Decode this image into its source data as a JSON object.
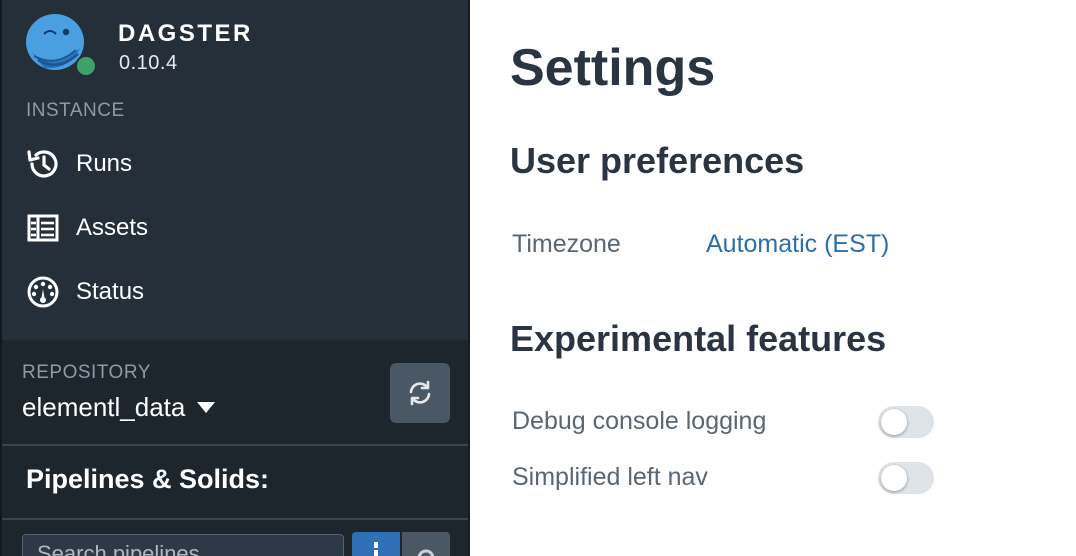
{
  "brand": {
    "name": "DAGSTER",
    "version": "0.10.4"
  },
  "sidebar": {
    "instance_label": "INSTANCE",
    "nav": [
      {
        "label": "Runs",
        "icon": "history-icon"
      },
      {
        "label": "Assets",
        "icon": "table-icon"
      },
      {
        "label": "Status",
        "icon": "dashboard-icon"
      }
    ],
    "repository_label": "REPOSITORY",
    "repository_value": "elementl_data",
    "pipelines_title": "Pipelines & Solids:",
    "search_placeholder": "Search pipelines..."
  },
  "main": {
    "title": "Settings",
    "user_prefs_title": "User preferences",
    "timezone_label": "Timezone",
    "timezone_value": "Automatic (EST)",
    "experimental_title": "Experimental features",
    "features": [
      {
        "label": "Debug console logging",
        "enabled": false
      },
      {
        "label": "Simplified left nav",
        "enabled": false
      }
    ]
  },
  "colors": {
    "sidebar_bg": "#252f3a",
    "repo_panel_bg": "#1d252d",
    "accent_blue": "#2e6fb5",
    "link_blue": "#2c6eae",
    "status_green": "#3fa06a",
    "heading_text": "#2b3541"
  }
}
